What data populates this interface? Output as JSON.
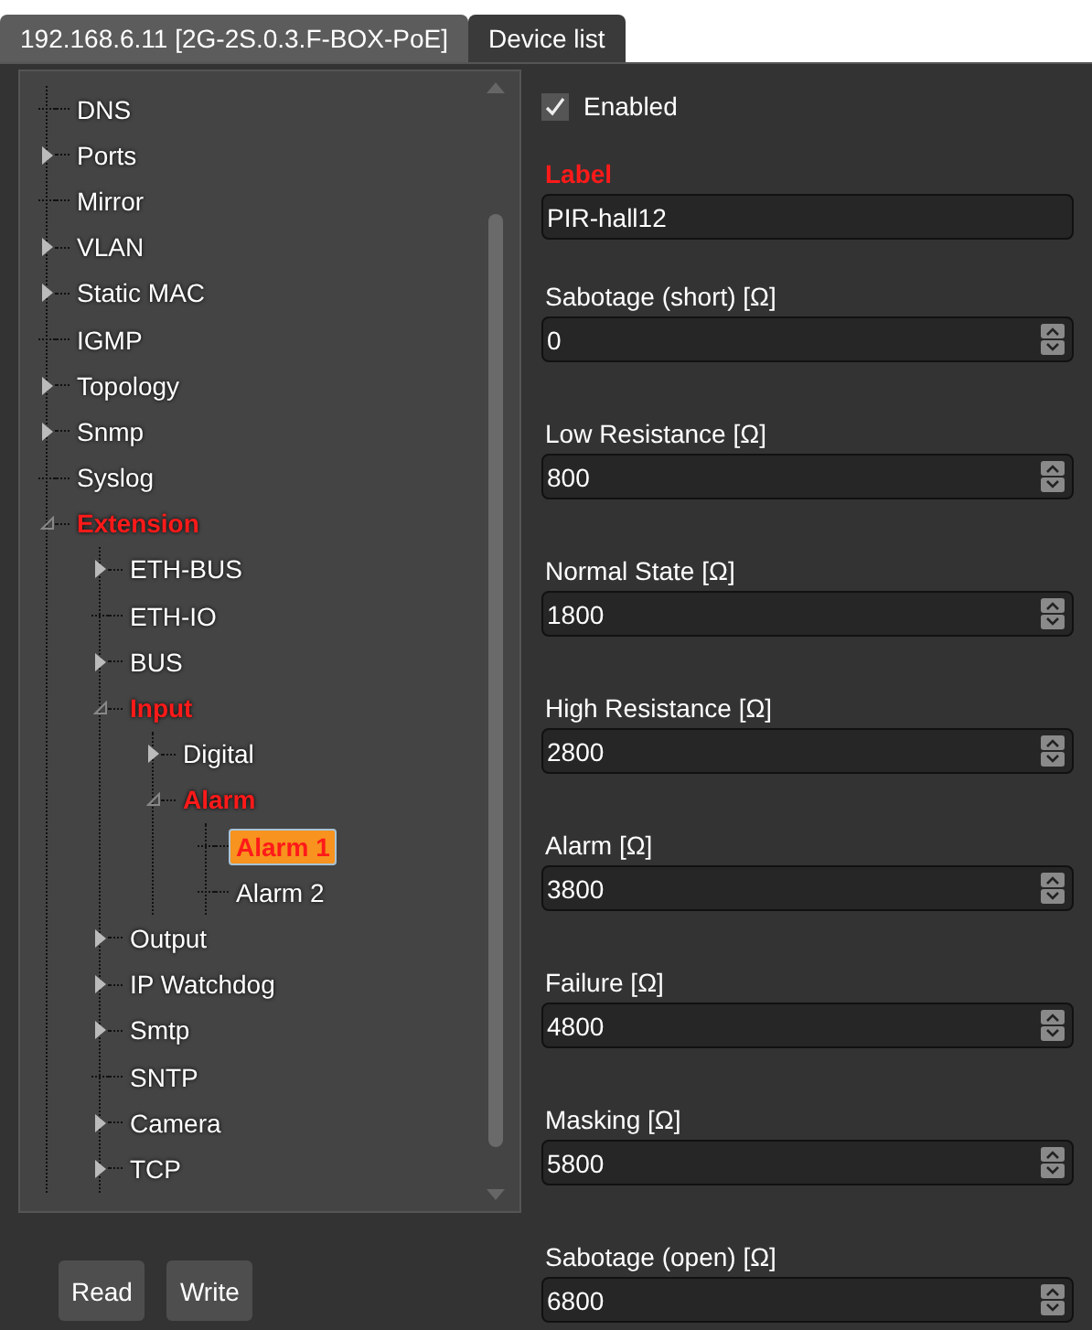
{
  "tabs": [
    {
      "label": "192.168.6.11 [2G-2S.0.3.F-BOX-PoE]",
      "selected": true
    },
    {
      "label": "Device list",
      "selected": false
    }
  ],
  "tree": [
    {
      "label": "DNS",
      "kind": "leaf",
      "selected": false
    },
    {
      "label": "Ports",
      "kind": "branch",
      "expanded": false,
      "selected": false
    },
    {
      "label": "Mirror",
      "kind": "leaf",
      "selected": false
    },
    {
      "label": "VLAN",
      "kind": "branch",
      "expanded": false,
      "selected": false
    },
    {
      "label": "Static MAC",
      "kind": "branch",
      "expanded": false,
      "selected": false
    },
    {
      "label": "IGMP",
      "kind": "leaf",
      "selected": false
    },
    {
      "label": "Topology",
      "kind": "branch",
      "expanded": false,
      "selected": false
    },
    {
      "label": "Snmp",
      "kind": "branch",
      "expanded": false,
      "selected": false
    },
    {
      "label": "Syslog",
      "kind": "leaf",
      "selected": false
    },
    {
      "label": "Extension",
      "kind": "branch",
      "expanded": true,
      "selected": false,
      "children": [
        {
          "label": "ETH-BUS",
          "kind": "branch",
          "expanded": false,
          "selected": false
        },
        {
          "label": "ETH-IO",
          "kind": "leaf",
          "selected": false
        },
        {
          "label": "BUS",
          "kind": "branch",
          "expanded": false,
          "selected": false
        },
        {
          "label": "Input",
          "kind": "branch",
          "expanded": true,
          "selected": false,
          "children": [
            {
              "label": "Digital",
              "kind": "branch",
              "expanded": false,
              "selected": false
            },
            {
              "label": "Alarm",
              "kind": "branch",
              "expanded": true,
              "selected": false,
              "children": [
                {
                  "label": "Alarm 1",
                  "kind": "leaf",
                  "selected": true
                },
                {
                  "label": "Alarm 2",
                  "kind": "leaf",
                  "selected": false
                }
              ]
            }
          ]
        },
        {
          "label": "Output",
          "kind": "branch",
          "expanded": false,
          "selected": false
        },
        {
          "label": "IP Watchdog",
          "kind": "branch",
          "expanded": false,
          "selected": false
        },
        {
          "label": "Smtp",
          "kind": "branch",
          "expanded": false,
          "selected": false
        },
        {
          "label": "SNTP",
          "kind": "leaf",
          "selected": false
        },
        {
          "label": "Camera",
          "kind": "branch",
          "expanded": false,
          "selected": false
        },
        {
          "label": "TCP",
          "kind": "branch",
          "expanded": false,
          "selected": false
        }
      ]
    }
  ],
  "buttons": [
    "Read",
    "Write"
  ],
  "enabled": {
    "label": "Enabled",
    "checked": true
  },
  "fields": [
    {
      "kind": "text",
      "label": "Label",
      "value": "PIR-hall12",
      "highlighted": true
    },
    {
      "kind": "spin",
      "label": "Sabotage (short) [Ω]",
      "value": "0",
      "highlighted": false
    },
    {
      "kind": "spin",
      "label": "Low Resistance [Ω]",
      "value": "800",
      "highlighted": false
    },
    {
      "kind": "spin",
      "label": "Normal State [Ω]",
      "value": "1800",
      "highlighted": false
    },
    {
      "kind": "spin",
      "label": "High Resistance [Ω]",
      "value": "2800",
      "highlighted": false
    },
    {
      "kind": "spin",
      "label": "Alarm [Ω]",
      "value": "3800",
      "highlighted": false
    },
    {
      "kind": "spin",
      "label": "Failure [Ω]",
      "value": "4800",
      "highlighted": false
    },
    {
      "kind": "spin",
      "label": "Masking [Ω]",
      "value": "5800",
      "highlighted": false
    },
    {
      "kind": "spin",
      "label": "Sabotage (open) [Ω]",
      "value": "6800",
      "highlighted": false
    }
  ]
}
